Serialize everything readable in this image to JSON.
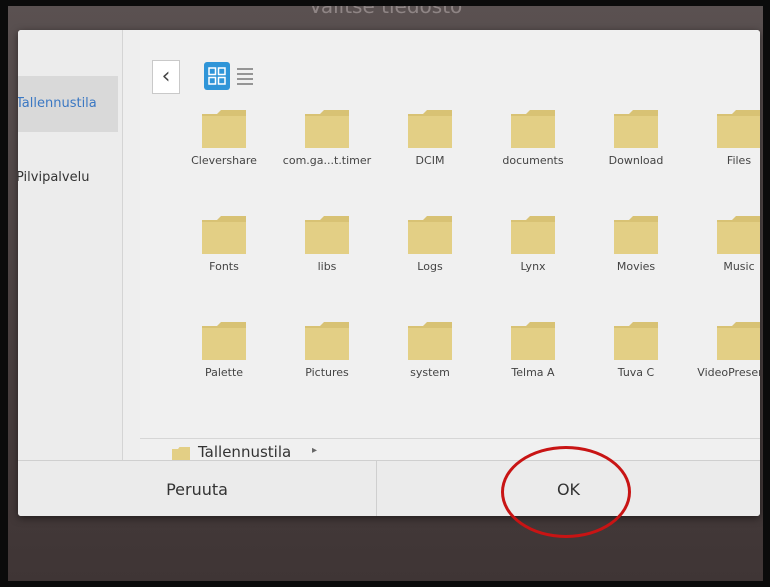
{
  "dialog": {
    "title": "Valitse tiedosto"
  },
  "sidebar": {
    "items": [
      {
        "label": "Tallennustila",
        "selected": true
      },
      {
        "label": "Pilvipalvelu",
        "selected": false
      }
    ]
  },
  "toolbar": {
    "back_icon": "chevron-left-icon",
    "view_grid_icon": "grid-view-icon",
    "view_list_icon": "list-view-icon",
    "accent_color": "#2f95d8"
  },
  "folders": [
    {
      "name": "Clevershare"
    },
    {
      "name": "com.ga...t.timer"
    },
    {
      "name": "DCIM"
    },
    {
      "name": "documents"
    },
    {
      "name": "Download"
    },
    {
      "name": "Files"
    },
    {
      "name": "Fonts"
    },
    {
      "name": "libs"
    },
    {
      "name": "Logs"
    },
    {
      "name": "Lynx"
    },
    {
      "name": "Movies"
    },
    {
      "name": "Music"
    },
    {
      "name": "Palette"
    },
    {
      "name": "Pictures"
    },
    {
      "name": "system"
    },
    {
      "name": "Telma A"
    },
    {
      "name": "Tuva C"
    },
    {
      "name": "VideoPresenter"
    }
  ],
  "pathbar": {
    "label": "Tallennustila",
    "arrow": "▸"
  },
  "buttons": {
    "cancel_label": "Peruuta",
    "ok_label": "OK"
  },
  "colors": {
    "folder": "#e3cf85",
    "folder_tab": "#d8c274",
    "annotation": "#c81414"
  }
}
